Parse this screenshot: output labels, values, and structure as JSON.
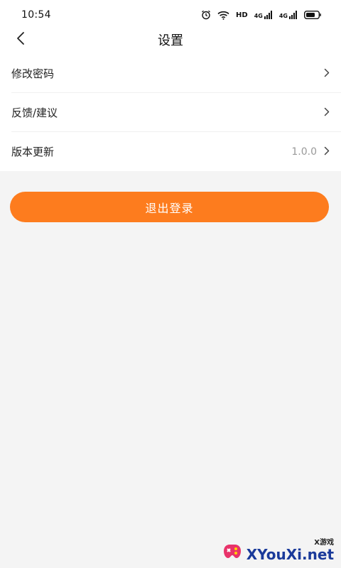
{
  "status_bar": {
    "time": "10:54",
    "hd": "HD",
    "net1": "4G",
    "net2": "4G"
  },
  "nav": {
    "title": "设置"
  },
  "menu": {
    "items": [
      {
        "label": "修改密码",
        "value": ""
      },
      {
        "label": "反馈/建议",
        "value": ""
      },
      {
        "label": "版本更新",
        "value": "1.0.0"
      }
    ]
  },
  "logout": {
    "label": "退出登录"
  },
  "watermark": {
    "small": "X游戏",
    "main": "XYouXi.net"
  },
  "colors": {
    "accent": "#fd7c1e",
    "background": "#f4f4f4",
    "card": "#ffffff"
  }
}
